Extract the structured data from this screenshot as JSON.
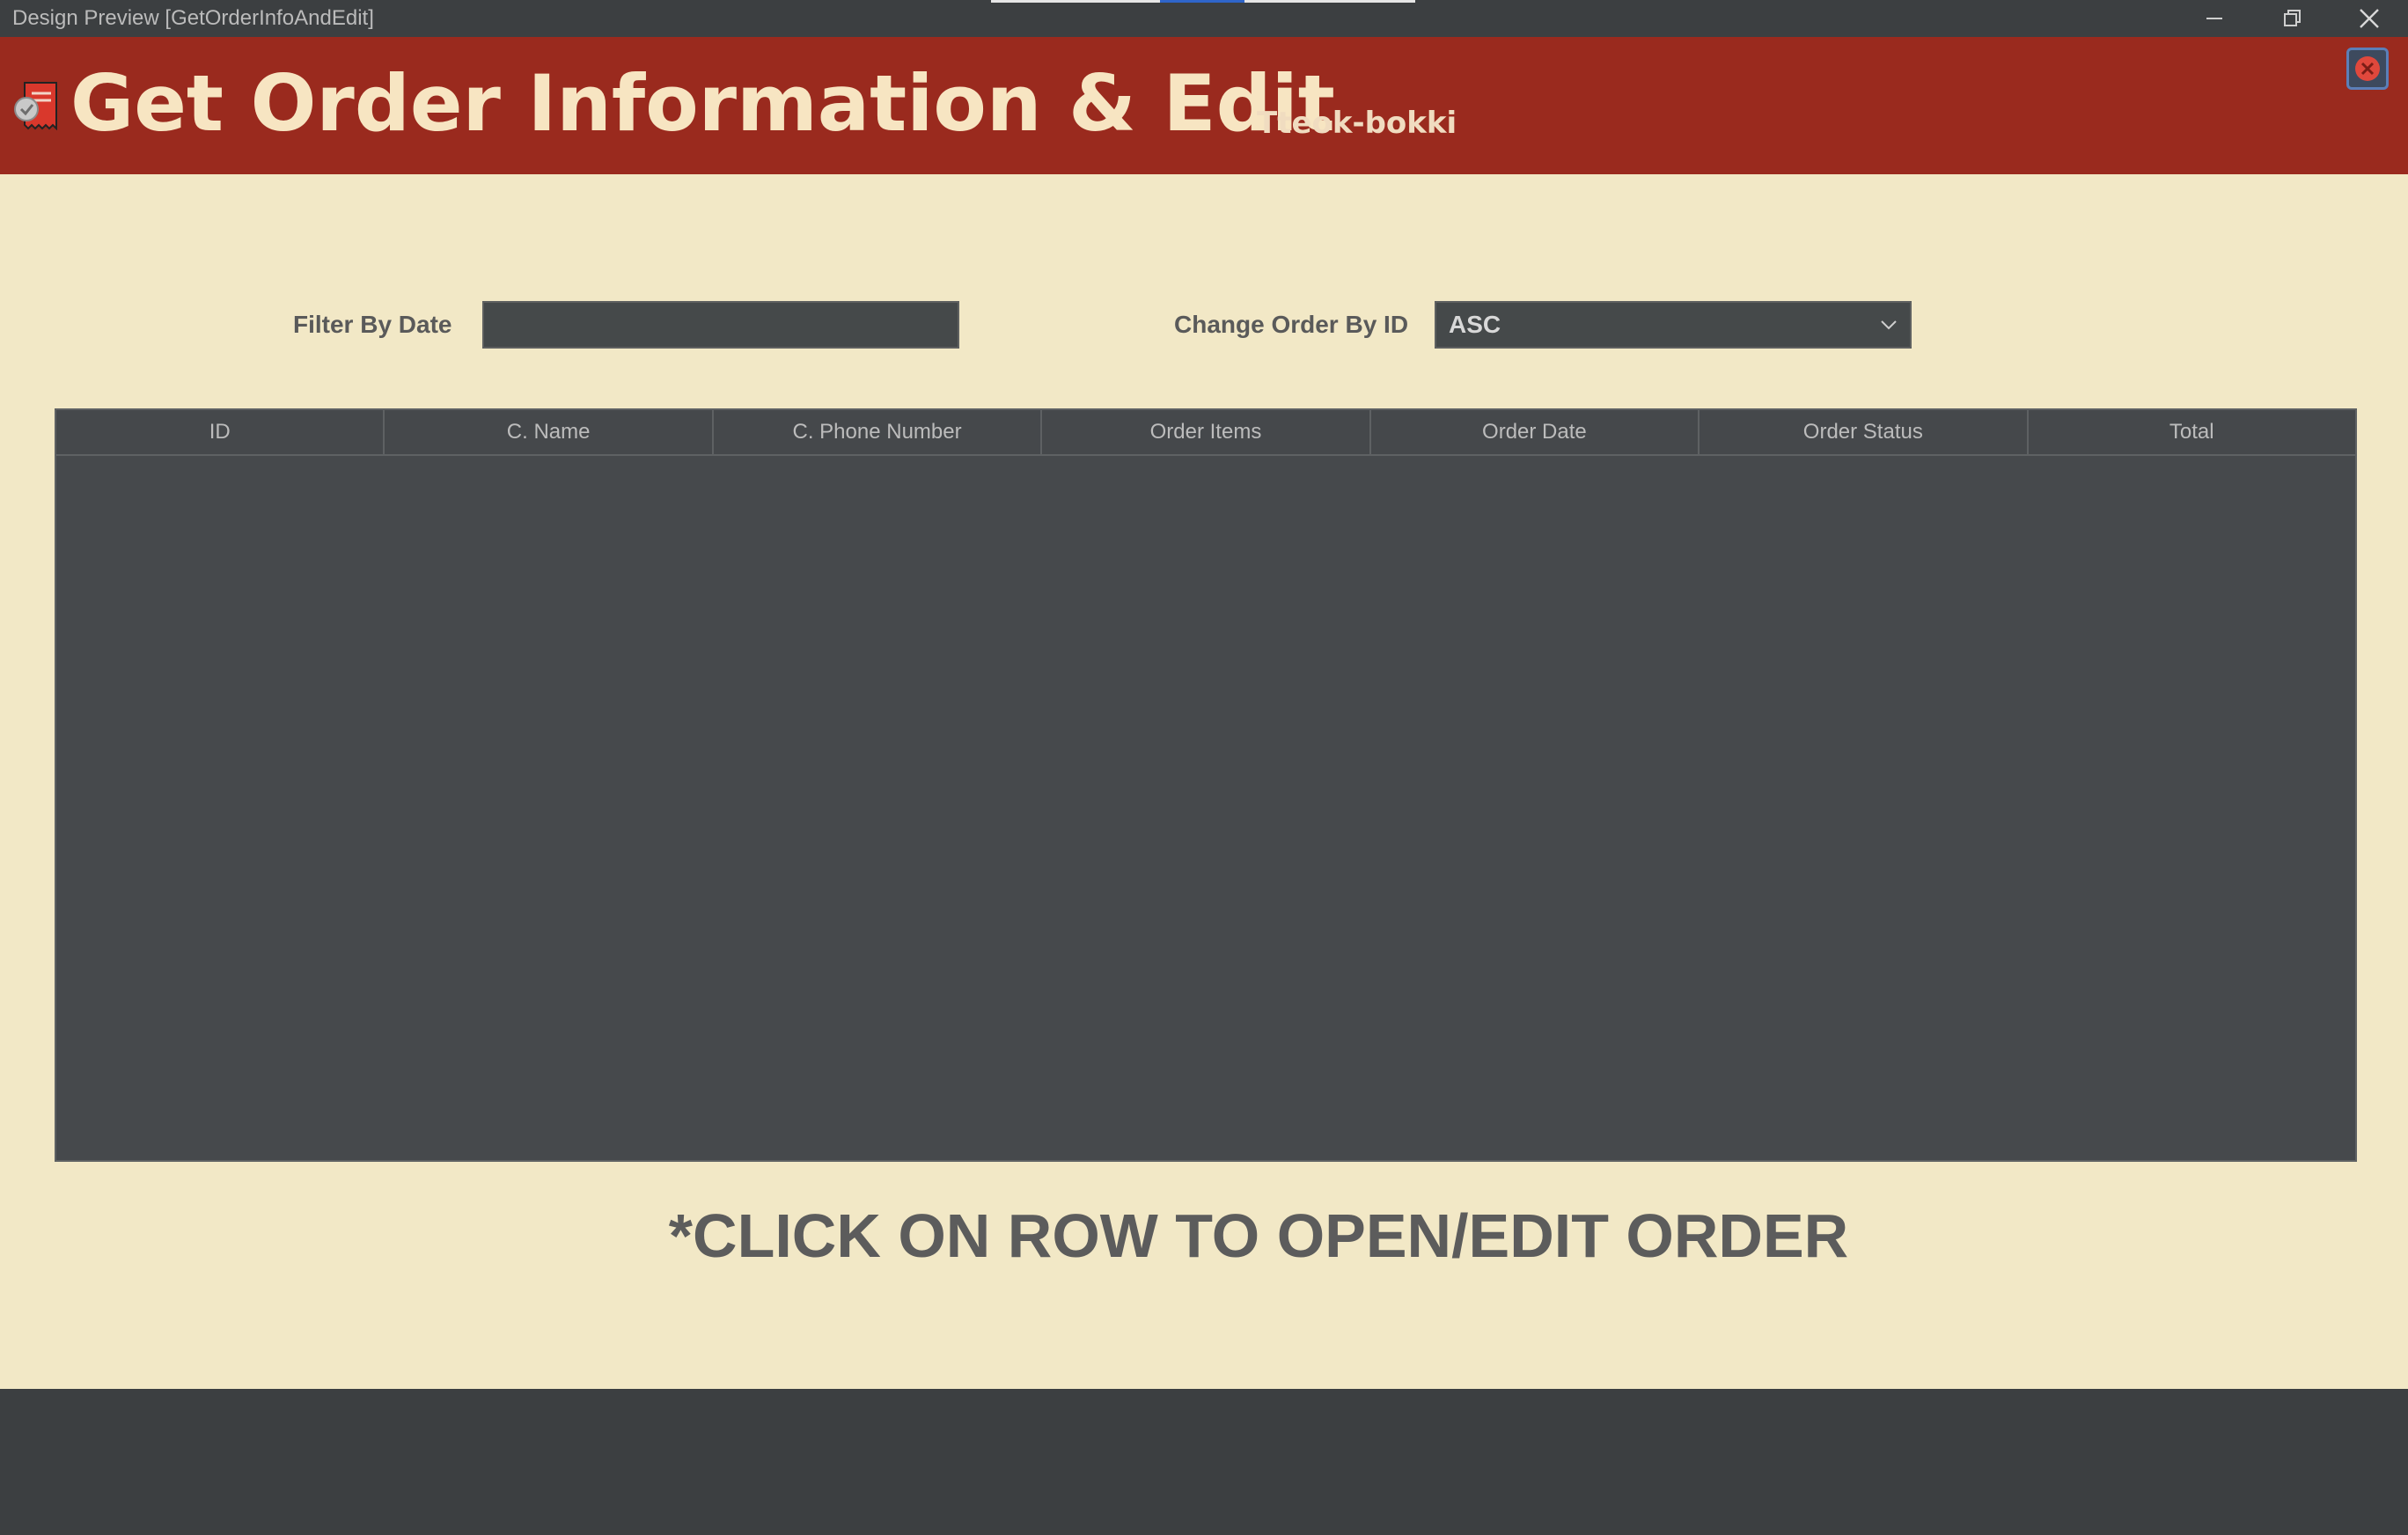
{
  "window": {
    "title": "Design Preview [GetOrderInfoAndEdit]",
    "controls": [
      "minimize",
      "restore",
      "close"
    ]
  },
  "header": {
    "title": "Get Order Information & Edit",
    "subtitle": "Tteok-bokki",
    "icon": "order-receipt-icon",
    "close_icon": "close-circle-icon",
    "colors": {
      "background": "#9a2a1e",
      "title": "#f7e5c2"
    }
  },
  "filters": {
    "date_label": "Filter By Date",
    "date_value": "",
    "order_label": "Change Order By ID",
    "order_selected": "ASC"
  },
  "table": {
    "columns": [
      "ID",
      "C. Name",
      "C. Phone Number",
      "Order Items",
      "Order Date",
      "Order Status",
      "Total"
    ],
    "rows": []
  },
  "hint": "*CLICK ON ROW TO OPEN/EDIT ORDER",
  "colors": {
    "body_background": "#f2e8c6",
    "table_background": "#46494c"
  }
}
